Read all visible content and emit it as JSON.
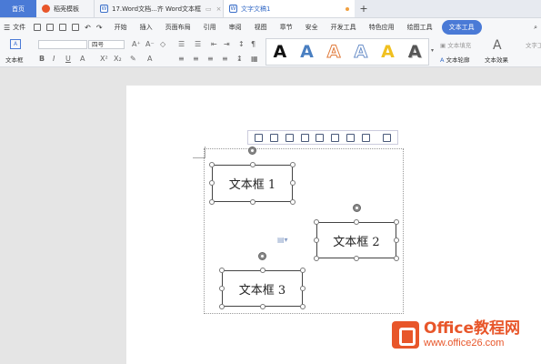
{
  "tabs": {
    "home": "首页",
    "t1": "稻壳模板",
    "t2": "17.Word文档...齐 Word文本框",
    "t3": "文字文稿1",
    "plus": "+"
  },
  "menu": {
    "file": "文件",
    "items": [
      "开始",
      "插入",
      "页面布局",
      "引用",
      "审阅",
      "视图",
      "章节",
      "安全",
      "开发工具",
      "特色应用",
      "绘图工具"
    ],
    "active": "文本工具"
  },
  "ribbon": {
    "textbox_label": "文本框",
    "font_size": "四号",
    "wordart_fill": "文本填充",
    "wordart_outline": "文本轮廓",
    "text_effect": "文本效果",
    "more": "文字工"
  },
  "document": {
    "textboxes": [
      {
        "label": "文本框 1"
      },
      {
        "label": "文本框 2"
      },
      {
        "label": "文本框 3"
      }
    ]
  },
  "watermark": {
    "title": "Office教程网",
    "url": "www.office26.com"
  },
  "colors": {
    "accent": "#4a7ad6",
    "brand_orange": "#e8562a"
  }
}
